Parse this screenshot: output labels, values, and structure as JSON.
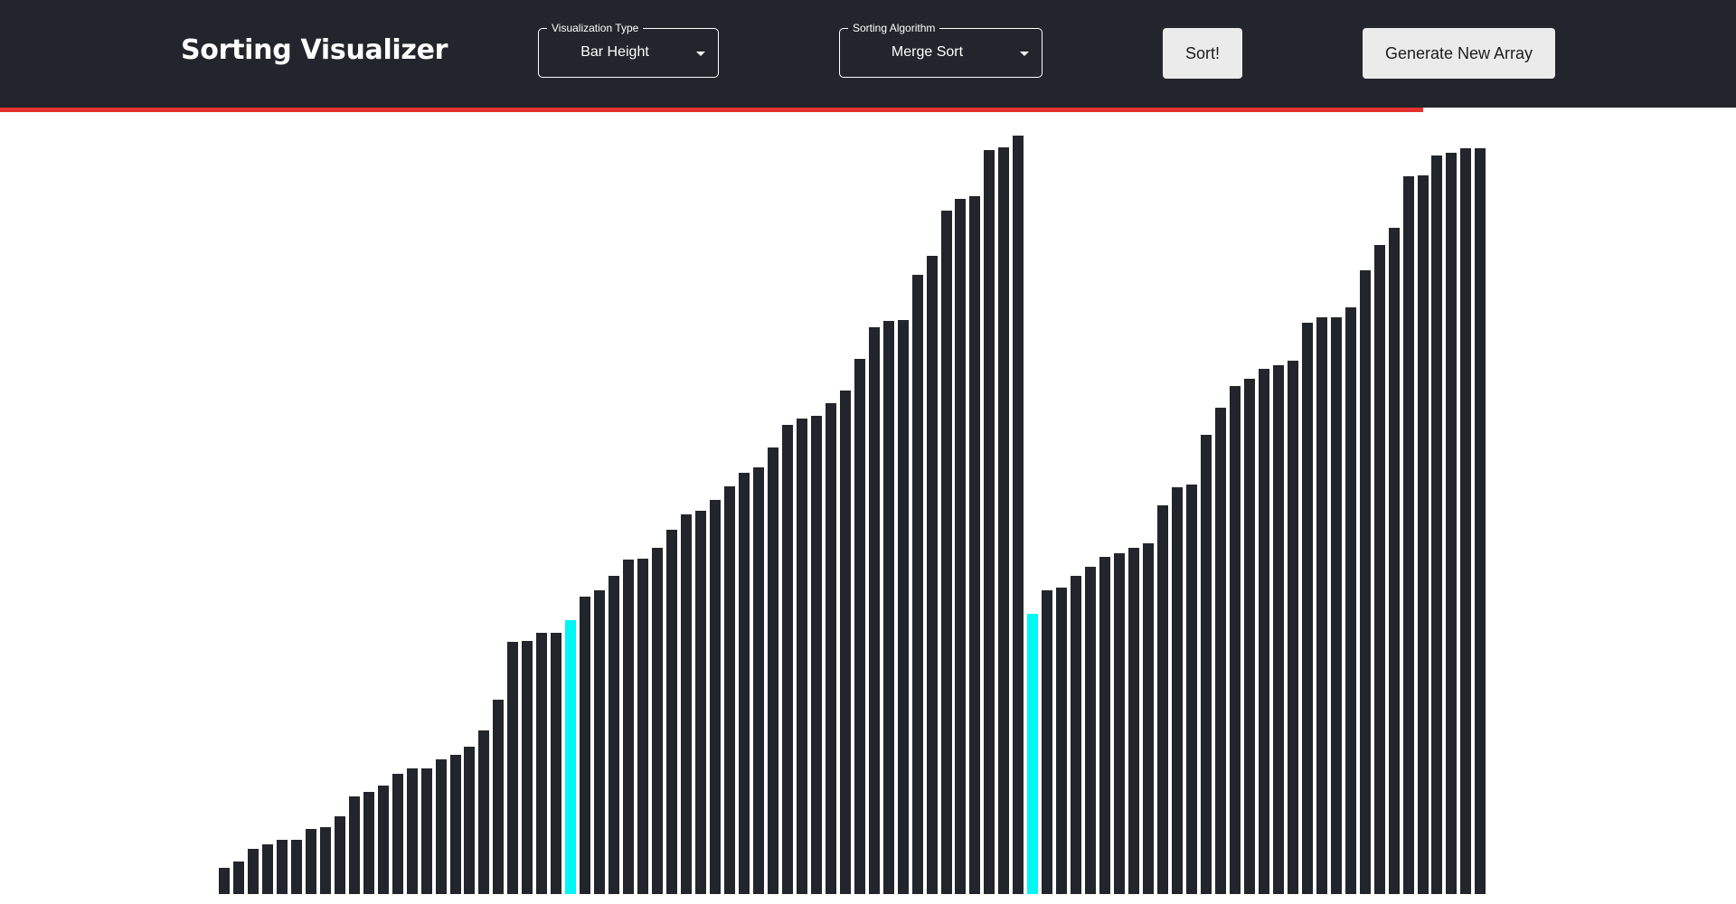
{
  "header": {
    "title": "Sorting Visualizer",
    "visualization_select": {
      "label": "Visualization Type",
      "value": "Bar Height"
    },
    "algorithm_select": {
      "label": "Sorting Algorithm",
      "value": "Merge Sort"
    },
    "sort_button": "Sort!",
    "generate_button": "Generate New Array"
  },
  "progress": {
    "fraction": 0.82,
    "color": "#e53030"
  },
  "bars": {
    "default_color": "#22252b",
    "highlight_color": "#00f5f5",
    "max_value": 100,
    "values": [
      3.5,
      4.3,
      5.9,
      6.5,
      7.2,
      7.2,
      8.6,
      8.8,
      10.2,
      12.9,
      13.5,
      14.3,
      15.9,
      16.6,
      16.6,
      17.8,
      18.4,
      19.4,
      21.6,
      25.6,
      33.3,
      33.4,
      34.5,
      34.5,
      36.1,
      39.2,
      40.0,
      41.9,
      44.1,
      44.2,
      45.6,
      48.0,
      50.0,
      50.5,
      52.0,
      53.8,
      55.5,
      56.2,
      58.9,
      61.9,
      62.7,
      63.1,
      64.7,
      66.4,
      70.6,
      74.7,
      75.6,
      75.7,
      81.6,
      84.2,
      90.1,
      91.6,
      92.0,
      98.1,
      98.4,
      100.0,
      37.0,
      40.0,
      40.4,
      42.0,
      43.2,
      44.5,
      44.9,
      45.6,
      46.2,
      51.3,
      53.6,
      54.0,
      60.6,
      64.1,
      67.0,
      67.9,
      69.3,
      69.7,
      70.3,
      75.3,
      76.0,
      76.1,
      77.4,
      82.2,
      85.6,
      87.8,
      94.6,
      94.7,
      97.4,
      97.7,
      98.3,
      98.3
    ],
    "highlighted": [
      24,
      56
    ]
  }
}
